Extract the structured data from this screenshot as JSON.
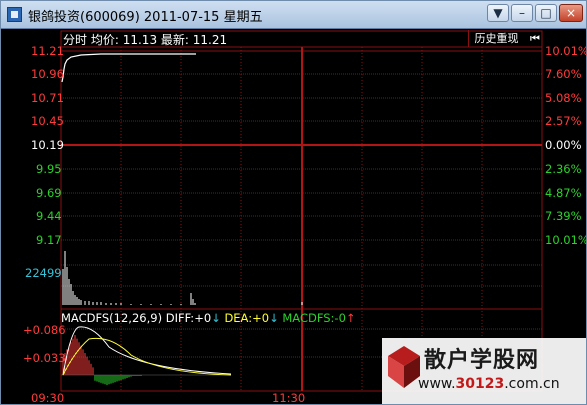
{
  "window": {
    "title": "银鸽投资(600069) 2011-07-15 星期五",
    "buttons": [
      "▼",
      "–",
      "□",
      "×"
    ]
  },
  "header": {
    "label_fenshi": "分时",
    "label_avg": "均价:",
    "avg_value": "11.13",
    "label_latest": "最新:",
    "latest_value": "11.21",
    "history_button": "历史重现",
    "history_icon": "⏮"
  },
  "price_axis": {
    "left": [
      {
        "text": "11.21",
        "color": "red"
      },
      {
        "text": "10.96",
        "color": "red"
      },
      {
        "text": "10.71",
        "color": "red"
      },
      {
        "text": "10.45",
        "color": "red"
      },
      {
        "text": "10.19",
        "color": "white"
      },
      {
        "text": "9.95",
        "color": "green"
      },
      {
        "text": "9.69",
        "color": "green"
      },
      {
        "text": "9.44",
        "color": "green"
      },
      {
        "text": "9.17",
        "color": "green"
      }
    ],
    "right": [
      {
        "text": "10.01%",
        "color": "red"
      },
      {
        "text": "7.60%",
        "color": "red"
      },
      {
        "text": "5.08%",
        "color": "red"
      },
      {
        "text": "2.57%",
        "color": "red"
      },
      {
        "text": "0.00%",
        "color": "white"
      },
      {
        "text": "2.36%",
        "color": "green"
      },
      {
        "text": "4.87%",
        "color": "green"
      },
      {
        "text": "7.39%",
        "color": "green"
      },
      {
        "text": "10.01%",
        "color": "green"
      }
    ]
  },
  "volume": {
    "max_label": "22499"
  },
  "macd": {
    "title": "MACDFS(12,26,9)",
    "diff_label": "DIFF:",
    "diff_value": "+0",
    "diff_arrow": "↓",
    "dea_label": "DEA:",
    "dea_value": "+0",
    "dea_arrow": "↓",
    "macdfs_label": "MACDFS:",
    "macdfs_value": "-0",
    "macdfs_arrow": "↑",
    "axis": [
      "+0.086",
      "+0.033"
    ]
  },
  "time_axis": [
    "09:30",
    "11:30"
  ],
  "watermark": {
    "name": "散户学股网",
    "url_prefix": "www.",
    "url_num": "30123",
    "url_suffix": ".com.cn"
  },
  "colors": {
    "grid": "#8a1111",
    "price_line": "#ffffff",
    "up": "#ff3b3b",
    "down": "#2cd22c",
    "volume_label": "#33c4d9"
  }
}
